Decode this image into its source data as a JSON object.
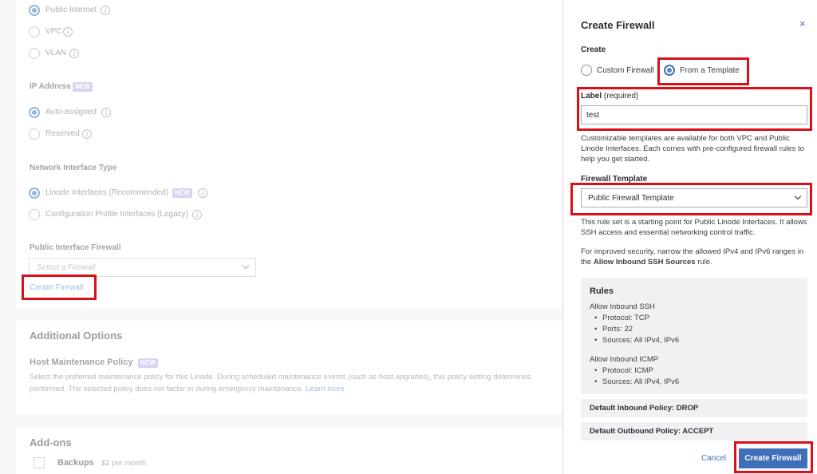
{
  "network": {
    "connection_options": [
      "Public Internet",
      "VPC",
      "VLAN"
    ],
    "ip_address_heading": "IP Address",
    "new_badge": "NEW",
    "ip_options": [
      "Auto-assigned",
      "Reserved"
    ],
    "interface_type_heading": "Network Interface Type",
    "interface_options": [
      "Linode Interfaces (Recommended)",
      "Configuration Profile Interfaces (Legacy)"
    ],
    "firewall_heading": "Public Interface Firewall",
    "firewall_placeholder": "Select a Firewall",
    "create_firewall_link": "Create Firewall"
  },
  "additional": {
    "heading": "Additional Options",
    "maintenance_heading": "Host Maintenance Policy",
    "maintenance_line1": "Select the preferred maintenance policy for this Linode. During scheduled maintenance events (such as host upgrades), this policy setting determines",
    "maintenance_line2": "performed. The selected policy does not factor in during emergency maintenance.",
    "learn_more": "Learn more."
  },
  "addons": {
    "heading": "Add-ons",
    "backups_label": "Backups",
    "backups_price": "$2 per month"
  },
  "drawer": {
    "title": "Create Firewall",
    "close_icon": "×",
    "create_heading": "Create",
    "custom_option": "Custom Firewall",
    "template_option": "From a Template",
    "label_heading": "Label",
    "label_required": "(required)",
    "label_value": "test",
    "templates_text": "Customizable templates are available for both VPC and Public Linode Interfaces. Each comes with pre-configured firewall rules to help you get started.",
    "template_heading": "Firewall Template",
    "template_value": "Public Firewall Template",
    "template_desc": "This rule set is a starting point for Public Linode Interfaces. It allows SSH access and essential networking control traffic.",
    "security_text_pre": "For improved security, narrow the allowed IPv4 and IPv6 ranges in the ",
    "security_text_bold": "Allow Inbound SSH Sources",
    "security_text_post": " rule.",
    "rules_heading": "Rules",
    "rule1_name": "Allow Inbound SSH",
    "rule1_protocol": "Protocol: TCP",
    "rule1_ports": "Ports: 22",
    "rule1_sources": "Sources: All IPv4, IPv6",
    "rule2_name": "Allow Inbound ICMP",
    "rule2_protocol": "Protocol: ICMP",
    "rule2_sources": "Sources: All IPv4, IPv6",
    "inbound_policy": "Default Inbound Policy: DROP",
    "outbound_policy": "Default Outbound Policy: ACCEPT",
    "cancel_label": "Cancel",
    "create_label": "Create Firewall"
  },
  "colors": {
    "accent": "#3f6fb8",
    "highlight": "#d7101a",
    "badge": "#c3b9ec"
  }
}
